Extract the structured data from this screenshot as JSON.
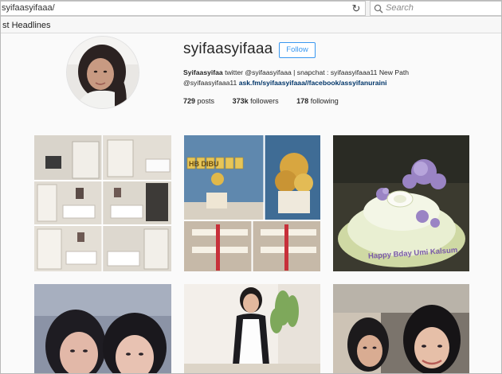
{
  "browser": {
    "url": "syifaasyifaaa/",
    "search_placeholder": "Search",
    "bookmarks_label": "st Headlines"
  },
  "profile": {
    "username": "syifaasyifaaa",
    "follow_label": "Follow",
    "bio": {
      "name": "Syifaasyifaa",
      "line1_text": " twitter @syifaasyifaaa | snapchat : syifaasyifaaa11 New Path",
      "line2_handle": "@syifaasyifaaa11 ",
      "line2_link": "ask.fm/syifaasyifaaa//facebook/assyifanuraini"
    },
    "stats": {
      "posts_count": "729",
      "posts_label": "posts",
      "followers_count": "373k",
      "followers_label": "followers",
      "following_count": "178",
      "following_label": "following"
    }
  },
  "posts": {
    "post3_caption": "Happy Bday Umi Kalsum",
    "post2_banner": "HB DIBU"
  },
  "colors": {
    "accent_blue": "#3897f0",
    "link_blue": "#003569",
    "background": "#fafafa"
  },
  "icons": [
    "reload-icon",
    "search-icon"
  ]
}
